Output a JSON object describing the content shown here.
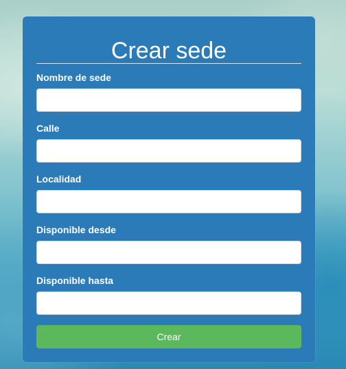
{
  "form": {
    "title": "Crear sede",
    "fields": [
      {
        "label": "Nombre de sede",
        "value": "",
        "placeholder": ""
      },
      {
        "label": "Calle",
        "value": "",
        "placeholder": ""
      },
      {
        "label": "Localidad",
        "value": "",
        "placeholder": ""
      },
      {
        "label": "Disponible desde",
        "value": "",
        "placeholder": ""
      },
      {
        "label": "Disponible hasta",
        "value": "",
        "placeholder": ""
      }
    ],
    "submit_label": "Crear"
  },
  "colors": {
    "card_background": "#2b7bb9",
    "submit_button": "#5cb85c",
    "text": "#ffffff"
  }
}
